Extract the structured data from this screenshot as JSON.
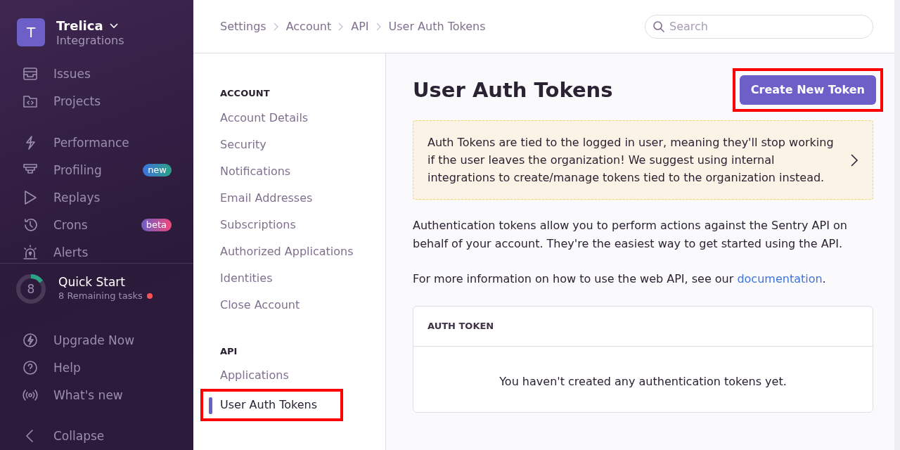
{
  "sidebar": {
    "org": {
      "initial": "T",
      "name": "Trelica",
      "subtitle": "Integrations"
    },
    "groups": [
      [
        {
          "label": "Issues"
        },
        {
          "label": "Projects"
        }
      ],
      [
        {
          "label": "Performance"
        },
        {
          "label": "Profiling",
          "badge": "new"
        },
        {
          "label": "Replays"
        },
        {
          "label": "Crons",
          "badge": "beta"
        },
        {
          "label": "Alerts"
        }
      ]
    ],
    "quick_start": {
      "count": "8",
      "title": "Quick Start",
      "subtitle": "8 Remaining tasks",
      "level": 0.15,
      "alert": true
    },
    "footer": [
      {
        "label": "Upgrade Now"
      },
      {
        "label": "Help"
      },
      {
        "label": "What's new"
      }
    ],
    "collapse": {
      "label": "Collapse"
    }
  },
  "breadcrumbs": [
    "Settings",
    "Account",
    "API",
    "User Auth Tokens"
  ],
  "search": {
    "placeholder": "Search"
  },
  "settings_nav": [
    {
      "heading": "ACCOUNT",
      "items": [
        {
          "label": "Account Details",
          "selected": false,
          "highlighted": false
        },
        {
          "label": "Security",
          "selected": false,
          "highlighted": false
        },
        {
          "label": "Notifications",
          "selected": false,
          "highlighted": false
        },
        {
          "label": "Email Addresses",
          "selected": false,
          "highlighted": false
        },
        {
          "label": "Subscriptions",
          "selected": false,
          "highlighted": false
        },
        {
          "label": "Authorized Applications",
          "selected": false,
          "highlighted": false
        },
        {
          "label": "Identities",
          "selected": false,
          "highlighted": false
        },
        {
          "label": "Close Account",
          "selected": false,
          "highlighted": false
        }
      ]
    },
    {
      "heading": "API",
      "items": [
        {
          "label": "Applications",
          "selected": false,
          "highlighted": false
        },
        {
          "label": "User Auth Tokens",
          "selected": true,
          "highlighted": true
        }
      ]
    }
  ],
  "page": {
    "title": "User Auth Tokens",
    "create_button": {
      "label": "Create New Token",
      "highlighted": true
    },
    "alert": "Auth Tokens are tied to the logged in user, meaning they'll stop working if the user leaves the organization! We suggest using internal integrations to create/manage tokens tied to the organization instead.",
    "description": "Authentication tokens allow you to perform actions against the Sentry API on behalf of your account. They're the easiest way to get started using the API.",
    "more_info": {
      "text": "For more information on how to use the web API, see our ",
      "link": "documentation",
      "after": "."
    },
    "panel": {
      "header": "AUTH TOKEN",
      "empty": "You haven't created any authentication tokens yet."
    }
  }
}
